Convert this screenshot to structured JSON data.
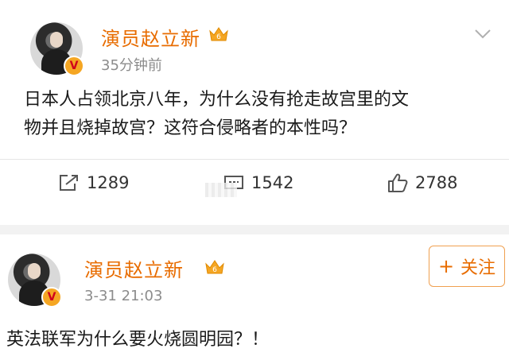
{
  "accent_color": "#e86c00",
  "posts": [
    {
      "author": "演员赵立新",
      "time": "35分钟前",
      "text_line1": "日本人占领北京八年，为什么没有抢走故宫里的文",
      "text_line2": "物并且烧掉故宫？这符合侵略者的本性吗？",
      "repost_count": "1289",
      "comment_count": "1542",
      "like_count": "2788",
      "icons": {
        "repost": "share-icon",
        "comment": "comment-icon",
        "like": "thumbs-up-icon",
        "menu": "chevron-down-icon"
      }
    },
    {
      "author": "演员赵立新",
      "time": "3-31 21:03",
      "text_line1": "英法联军为什么要火烧圆明园？！",
      "follow_label": "关注",
      "follow_plus": "+"
    }
  ]
}
